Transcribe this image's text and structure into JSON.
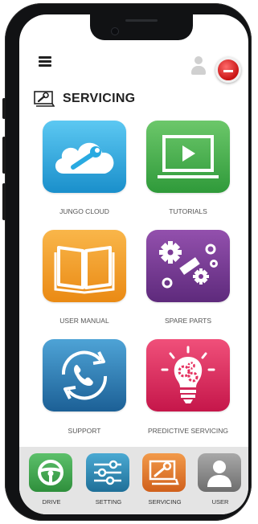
{
  "header": {
    "menu_icon": "hamburger-menu-icon",
    "user_icon": "user-silhouette-icon",
    "power_icon": "power-button-icon",
    "title": "SERVICING",
    "title_icon": "servicing-wrench-icon"
  },
  "tiles": [
    {
      "label": "JUNGO CLOUD",
      "icon": "cloud-wrench-icon",
      "color": "#29aae1"
    },
    {
      "label": "TUTORIALS",
      "icon": "video-play-icon",
      "color": "#46b34a"
    },
    {
      "label": "USER MANUAL",
      "icon": "open-book-icon",
      "color": "#f39a1e"
    },
    {
      "label": "SPARE PARTS",
      "icon": "gears-parts-icon",
      "color": "#7b3a96"
    },
    {
      "label": "SUPPORT",
      "icon": "phone-sync-icon",
      "color": "#2e7fb8"
    },
    {
      "label": "PREDICTIVE SERVICING",
      "icon": "lightbulb-gears-icon",
      "color": "#e5305f"
    }
  ],
  "bottom_nav": [
    {
      "label": "DRIVE",
      "icon": "steering-wheel-icon",
      "color": "#3fa848"
    },
    {
      "label": "SETTING",
      "icon": "sliders-icon",
      "color": "#2f8fb8"
    },
    {
      "label": "SERVICING",
      "icon": "servicing-wrench-icon",
      "color": "#e8752a"
    },
    {
      "label": "USER",
      "icon": "user-silhouette-icon",
      "color": "#8d8d8d"
    }
  ],
  "colors": {
    "phone_body": "#111214",
    "screen_bg": "#ffffff",
    "bottom_bar": "#e4e4e4",
    "power_red": "#d01818"
  }
}
